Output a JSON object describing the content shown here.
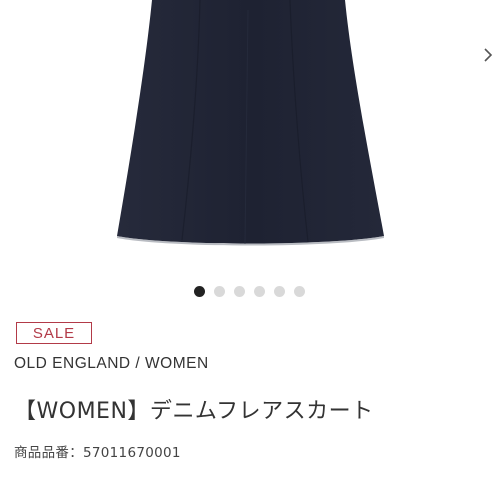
{
  "gallery": {
    "total_images": 6,
    "active_index": 0,
    "skirt_color": "#1f2333"
  },
  "product": {
    "sale_label": "SALE",
    "brand": "OLD ENGLAND / WOMEN",
    "title": "【WOMEN】デニムフレアスカート",
    "number_label": "商品品番：",
    "number": "57011670001"
  },
  "colors": {
    "sale_accent": "#b23a48",
    "text": "#333333",
    "dot_active": "#222222",
    "dot_inactive": "#d9d9d9"
  },
  "icons": {
    "next": "chevron-right-icon"
  }
}
